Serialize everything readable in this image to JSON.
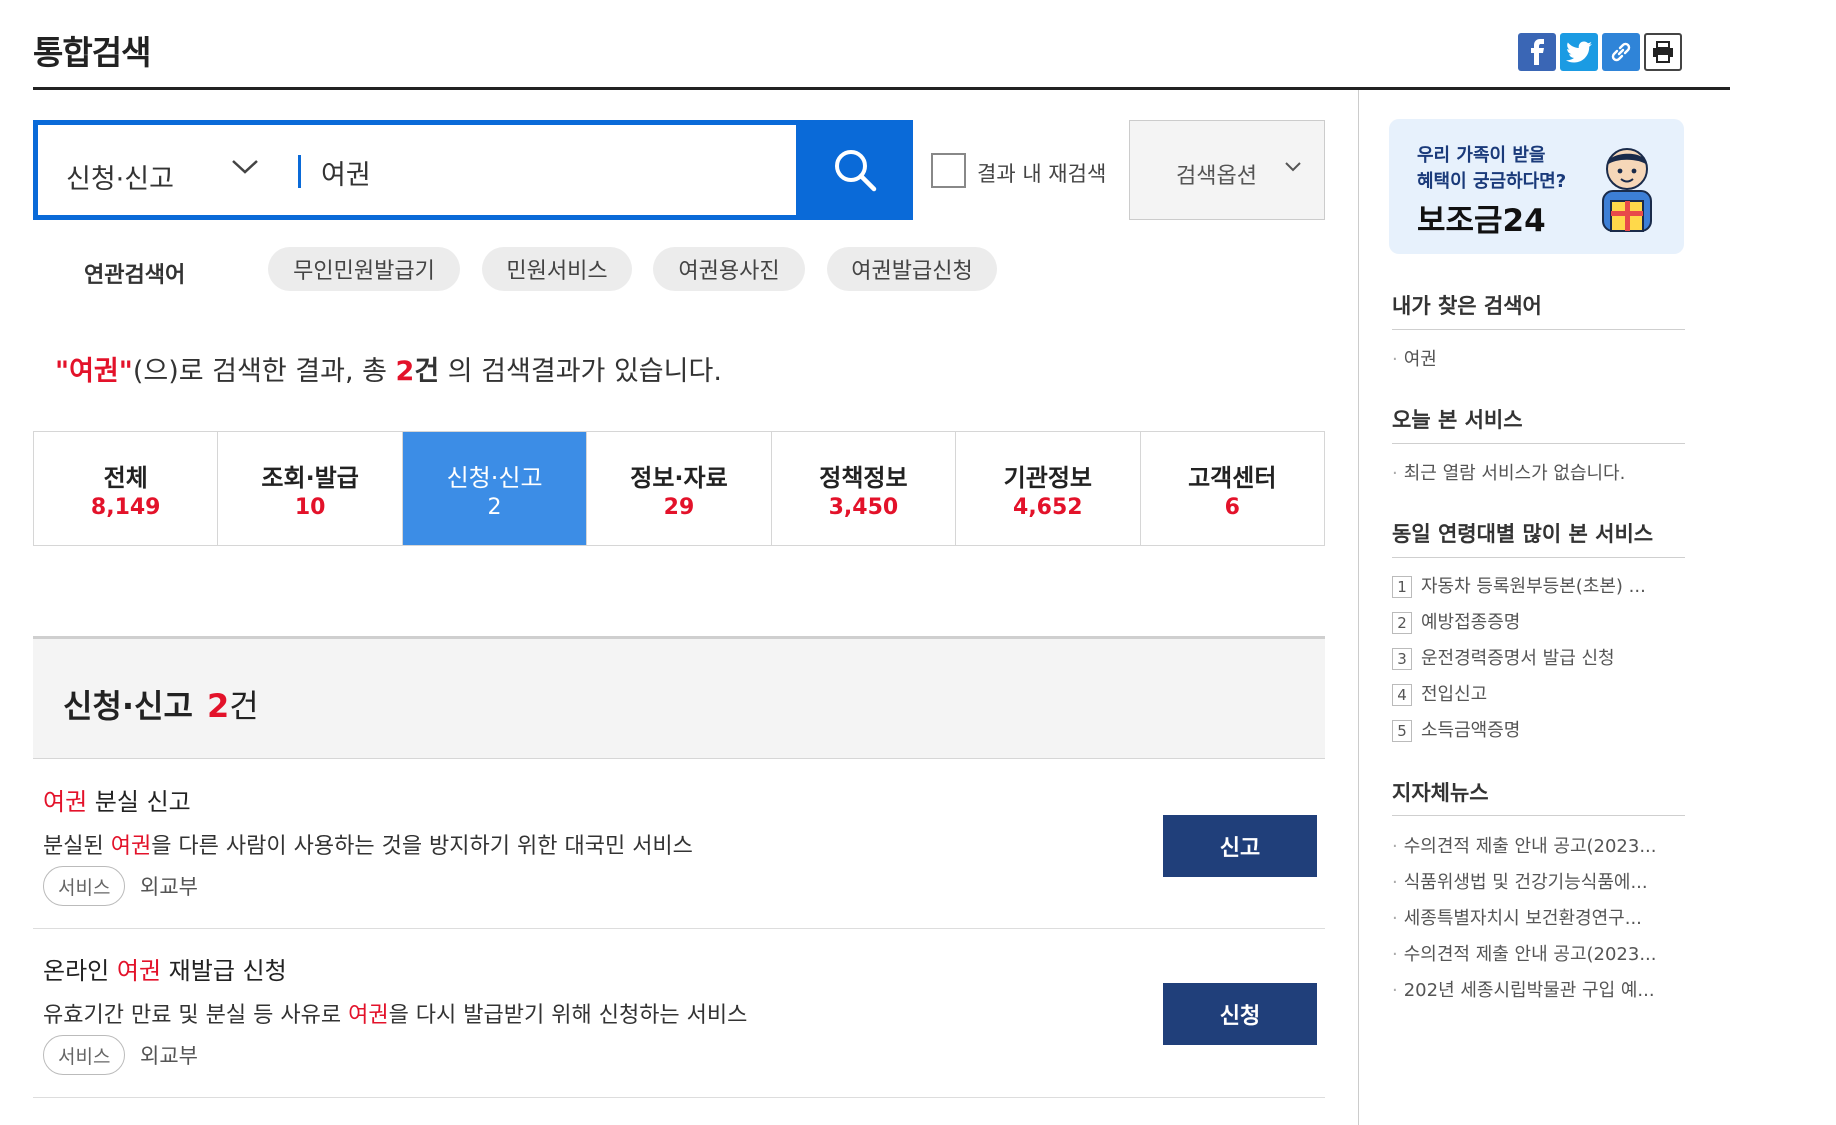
{
  "header": {
    "title": "통합검색",
    "share_icons": [
      "facebook-icon",
      "twitter-icon",
      "link-icon",
      "print-icon"
    ]
  },
  "search": {
    "category": "신청·신고",
    "query": "여권",
    "re_search_label": "결과 내 재검색",
    "options_label": "검색옵션"
  },
  "related": {
    "title": "연관검색어",
    "items": [
      "무인민원발급기",
      "민원서비스",
      "여권용사진",
      "여권발급신청"
    ]
  },
  "summary": {
    "keyword": "\"여권\"",
    "text1": "(으)로 검색한 결과, 총 ",
    "count": "2",
    "unit": "건",
    "text2": " 의 검색결과가 있습니다."
  },
  "tabs": [
    {
      "name": "전체",
      "count": "8,149"
    },
    {
      "name": "조회·발급",
      "count": "10"
    },
    {
      "name": "신청·신고",
      "count": "2",
      "active": true
    },
    {
      "name": "정보·자료",
      "count": "29"
    },
    {
      "name": "정책정보",
      "count": "3,450"
    },
    {
      "name": "기관정보",
      "count": "4,652"
    },
    {
      "name": "고객센터",
      "count": "6"
    }
  ],
  "section": {
    "title": "신청·신고",
    "count": "2",
    "unit": "건"
  },
  "results": [
    {
      "title_pre": "",
      "title_hl": "여권",
      "title_post": " 분실 신고",
      "desc_pre": "분실된 ",
      "desc_hl": "여권",
      "desc_post": "을 다른 사람이 사용하는 것을 방지하기 위한 대국민 서비스",
      "tag": "서비스",
      "org": "외교부",
      "button": "신고"
    },
    {
      "title_pre": "온라인 ",
      "title_hl": "여권",
      "title_post": " 재발급 신청",
      "desc_pre": "유효기간 만료 및 분실 등 사유로 ",
      "desc_hl": "여권",
      "desc_post": "을 다시 발급받기 위해 신청하는 서비스",
      "tag": "서비스",
      "org": "외교부",
      "button": "신청"
    }
  ],
  "sidebar": {
    "banner": {
      "line1": "우리 가족이 받을",
      "line2": "혜택이 궁금하다면?",
      "brand": "보조금24"
    },
    "my_searches": {
      "title": "내가 찾은 검색어",
      "items": [
        "여권"
      ]
    },
    "today_services": {
      "title": "오늘 본 서비스",
      "items": [
        "최근 열람 서비스가 없습니다."
      ]
    },
    "popular": {
      "title": "동일 연령대별 많이 본 서비스",
      "items": [
        {
          "rank": "1",
          "label": "자동차 등록원부등본(초본) ..."
        },
        {
          "rank": "2",
          "label": "예방접종증명"
        },
        {
          "rank": "3",
          "label": "운전경력증명서 발급 신청"
        },
        {
          "rank": "4",
          "label": "전입신고"
        },
        {
          "rank": "5",
          "label": "소득금액증명"
        }
      ]
    },
    "news": {
      "title": "지자체뉴스",
      "items": [
        "수의견적 제출 안내 공고(2023...",
        "식품위생법 및 건강기능식품에...",
        "세종특별자치시 보건환경연구...",
        "수의견적 제출 안내 공고(2023...",
        "202년 세종시립박물관 구입 예..."
      ]
    }
  },
  "colors": {
    "accent": "#0a6ad8",
    "highlight": "#e3122a",
    "active_tab": "#3c8de6",
    "action_button": "#203f7a"
  }
}
